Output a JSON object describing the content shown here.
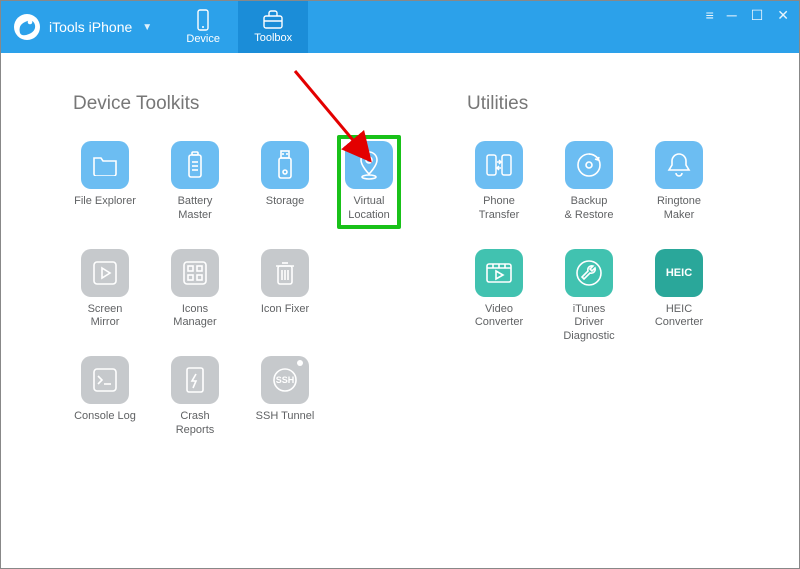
{
  "header": {
    "brand": "iTools iPhone",
    "tabs": {
      "device": "Device",
      "toolbox": "Toolbox"
    }
  },
  "sections": {
    "device_toolkits": {
      "title": "Device Toolkits",
      "tools": {
        "file_explorer": {
          "label": "File Explorer"
        },
        "battery_master": {
          "label": "Battery Master"
        },
        "storage": {
          "label": "Storage"
        },
        "virtual_location": {
          "label": "Virtual Location"
        },
        "screen_mirror": {
          "label": "Screen Mirror"
        },
        "icons_manager": {
          "label": "Icons Manager"
        },
        "icon_fixer": {
          "label": "Icon Fixer"
        },
        "console_log": {
          "label": "Console Log"
        },
        "crash_reports": {
          "label": "Crash Reports"
        },
        "ssh_tunnel": {
          "label": "SSH Tunnel"
        }
      }
    },
    "utilities": {
      "title": "Utilities",
      "tools": {
        "phone_transfer": {
          "label": "Phone Transfer"
        },
        "backup_restore": {
          "label": "Backup\n& Restore"
        },
        "ringtone_maker": {
          "label": "Ringtone Maker"
        },
        "video_converter": {
          "label": "Video\nConverter"
        },
        "itunes_diag": {
          "label": "iTunes Driver\nDiagnostic"
        },
        "heic_converter": {
          "label": "HEIC Converter"
        }
      }
    }
  }
}
